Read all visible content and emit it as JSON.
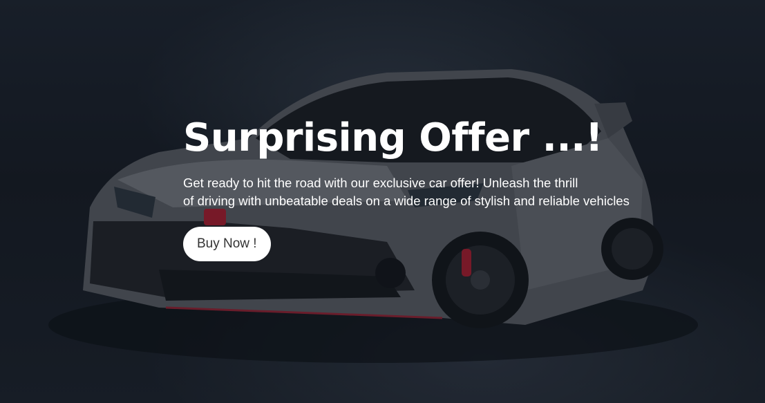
{
  "hero": {
    "title": "Surprising Offer ...!",
    "description_line1": "Get ready to hit the road with our exclusive car offer! Unleash the thrill",
    "description_line2": "of driving with unbeatable deals on a wide range of stylish and reliable vehicles",
    "cta_label": "Buy Now !",
    "background_image": "car-photo"
  },
  "colors": {
    "text": "#ffffff",
    "button_bg": "#ffffff",
    "button_text": "#333333",
    "background_dark": "#1a1f28"
  }
}
